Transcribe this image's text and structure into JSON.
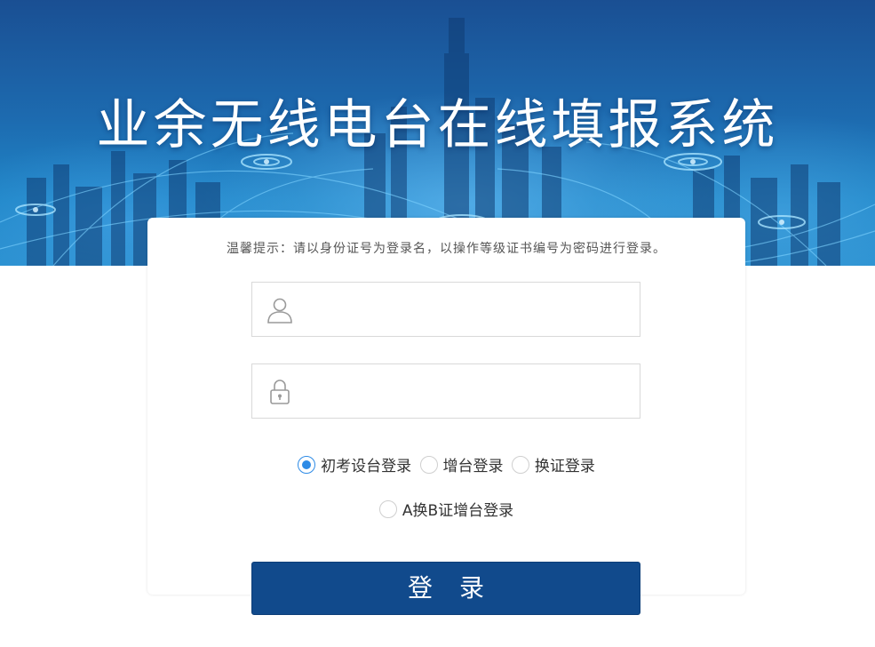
{
  "banner": {
    "title": "业余无线电台在线填报系统"
  },
  "login": {
    "notice": "温馨提示：请以身份证号为登录名，以操作等级证书编号为密码进行登录。",
    "username": {
      "value": "",
      "placeholder": "",
      "icon": "user-icon"
    },
    "password": {
      "value": "",
      "placeholder": "",
      "icon": "lock-icon"
    },
    "login_types": [
      {
        "label": "初考设台登录",
        "checked": true
      },
      {
        "label": "增台登录",
        "checked": false
      },
      {
        "label": "换证登录",
        "checked": false
      },
      {
        "label": "A换B证增台登录",
        "checked": false
      }
    ],
    "submit_label": "登录"
  },
  "colors": {
    "button": "#114a8c",
    "radio_checked": "#2e8be6",
    "banner_top": "#1a4f93"
  }
}
